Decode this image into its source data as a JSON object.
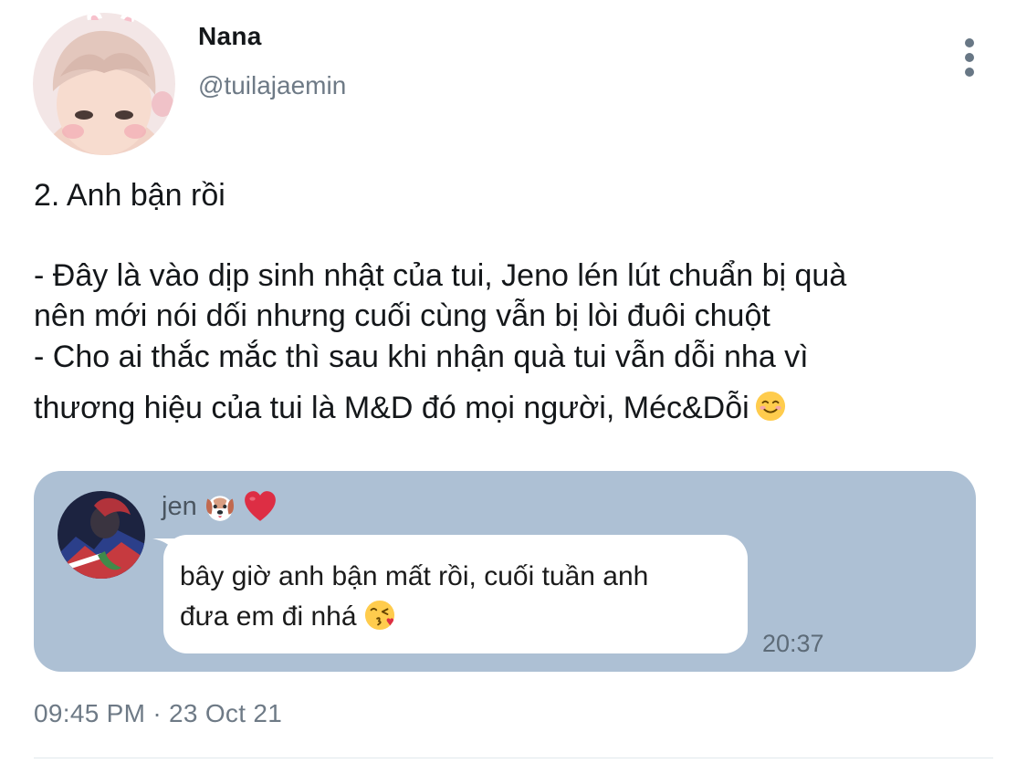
{
  "author": {
    "display_name": "Nana",
    "handle": "@tuilajaemin"
  },
  "tweet": {
    "lines": [
      "2. Anh bận rồi",
      "- Đây là vào dịp sinh nhật của tui, Jeno lén lút chuẩn bị quà",
      "nên mới nói dối nhưng cuối cùng vẫn bị lòi đuôi chuột",
      "- Cho ai thắc mắc thì sau khi nhận quà tui vẫn dỗi nha vì",
      "thương hiệu của tui là M&D đó mọi người, Méc&Dỗi"
    ],
    "timestamp": "09:45 PM · 23 Oct 21"
  },
  "chat_image": {
    "sender_name": "jen",
    "message_lines": [
      "bây giờ anh bận mất rồi, cuối tuần anh",
      "đưa em đi nhá"
    ],
    "time": "20:37",
    "background_color": "#adc0d4"
  },
  "icons": {
    "more": "more-vertical-icon",
    "emoji_1": "smiling-face-icon",
    "emoji_2": "dog-face-icon",
    "emoji_3": "red-heart-icon",
    "emoji_4": "face-blowing-kiss-icon"
  }
}
